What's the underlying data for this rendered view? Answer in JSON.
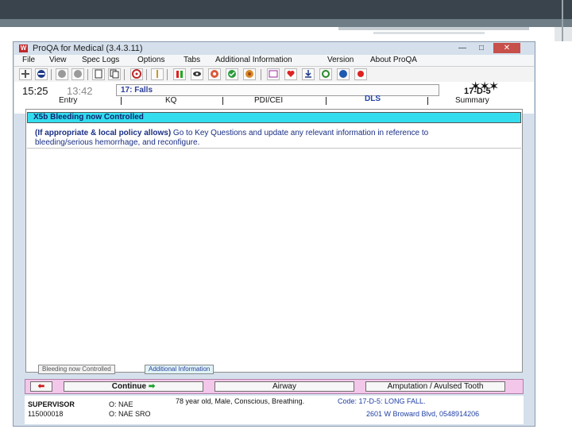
{
  "window": {
    "title": "ProQA for Medical (3.4.3.11)",
    "icon_label": "W",
    "controls": [
      "—",
      "□",
      "✕"
    ]
  },
  "menu": [
    "File",
    "View",
    "Spec Logs",
    "Options",
    "Tabs",
    "Additional Information",
    "Version",
    "About ProQA"
  ],
  "toolbar": {
    "icons": [
      "plus-icon",
      "minus-icon",
      "phone-icon",
      "phone2-icon",
      "document-icon",
      "copy-icon",
      "target-icon",
      "pen-icon",
      "stoplight-icon",
      "eye-icon",
      "fan-icon",
      "check-icon",
      "gear-icon",
      "screen-icon",
      "heart-icon",
      "download-icon",
      "recycle-icon",
      "help-icon",
      "record-icon"
    ]
  },
  "times": {
    "main": "15:25",
    "sub": "13:42"
  },
  "protocol": "17: Falls",
  "determinant": {
    "code": "17-D-5",
    "logo": "✶✶✶"
  },
  "tabs": [
    {
      "label": "Entry",
      "active": false
    },
    {
      "label": "KQ",
      "active": false
    },
    {
      "label": "PDI/CEI",
      "active": false
    },
    {
      "label": "DLS",
      "active": true
    },
    {
      "label": "Summary",
      "active": false
    }
  ],
  "content": {
    "header": "X5b Bleeding now Controlled",
    "instruction_bold": "(If appropriate & local policy allows)",
    "instruction_rest": " Go to Key Questions and update any relevant information in reference to bleeding/serious hemorrhage, and reconfigure."
  },
  "bottom_tabs": [
    "Bleeding now Controlled",
    "Additional Information"
  ],
  "actions": {
    "back": "⬅",
    "continue_label": "Continue",
    "continue_arrow": "➡",
    "airway": "Airway",
    "amputation": "Amputation / Avulsed Tooth"
  },
  "status": {
    "user": "SUPERVISOR",
    "incident": "115000018",
    "field1": "O: NAE",
    "field2": "O: NAE  SRO",
    "summary": "78 year old, Male, Conscious, Breathing.",
    "code_label": "Code: 17-D-5: LONG FALL.",
    "address": "2601 W Broward Blvd, 0548914206"
  },
  "colors": {
    "slide_bar": "#3a444d",
    "cyan_header": "#33ddee",
    "action_bar": "#f2c7ea",
    "text_blue": "#1a2f84"
  }
}
